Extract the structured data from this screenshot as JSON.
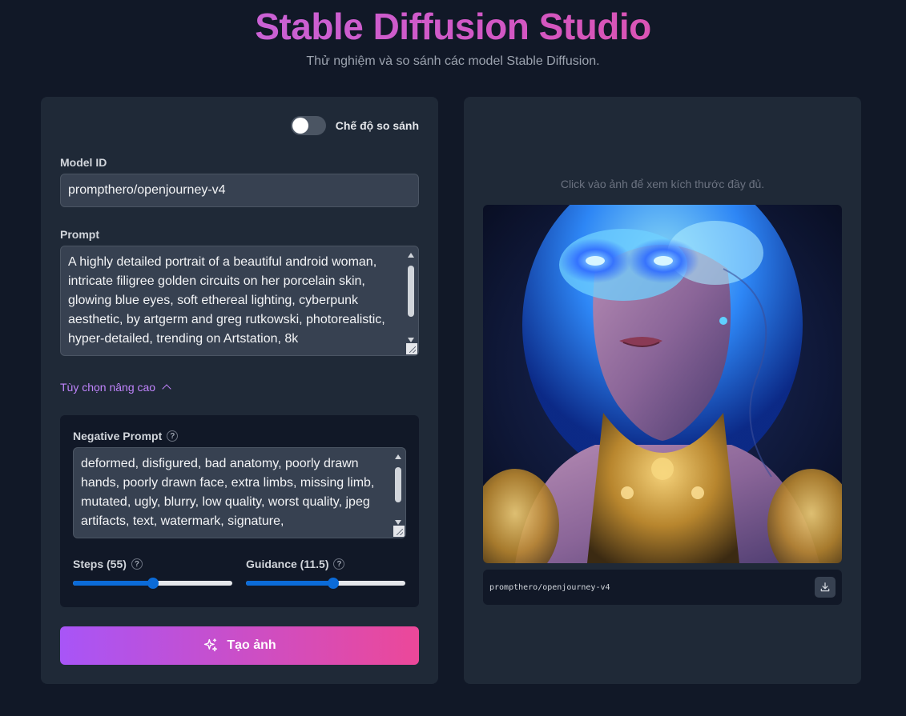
{
  "header": {
    "title": "Stable Diffusion Studio",
    "subtitle": "Thử nghiệm và so sánh các model Stable Diffusion."
  },
  "left_panel": {
    "compare_toggle": {
      "label": "Chế độ so sánh",
      "on": false
    },
    "model_id": {
      "label": "Model ID",
      "value": "prompthero/openjourney-v4"
    },
    "prompt": {
      "label": "Prompt",
      "value": "A highly detailed portrait of a beautiful android woman, intricate filigree golden circuits on her porcelain skin, glowing blue eyes, soft ethereal lighting, cyberpunk aesthetic, by artgerm and greg rutkowski, photorealistic, hyper-detailed, trending on Artstation, 8k"
    },
    "advanced": {
      "label": "Tùy chọn nâng cao",
      "expanded": true,
      "negative_prompt": {
        "label": "Negative Prompt",
        "value": "deformed, disfigured, bad anatomy, poorly drawn hands, poorly drawn face, extra limbs, missing limb, mutated, ugly, blurry, low quality, worst quality, jpeg artifacts, text, watermark, signature,"
      },
      "steps": {
        "label": "Steps (55)",
        "value": 55,
        "fraction": 0.5
      },
      "guidance": {
        "label": "Guidance (11.5)",
        "value": 11.5,
        "fraction": 0.55
      }
    },
    "generate_button": {
      "label": "Tạo ảnh",
      "icon": "sparkles-icon"
    }
  },
  "right_panel": {
    "hint": "Click vào ảnh để xem kích thước đầy đủ.",
    "image_caption": "prompthero/openjourney-v4",
    "download_icon": "download-icon"
  },
  "colors": {
    "background": "#111827",
    "panel": "#1f2937",
    "accent_purple": "#a855f7",
    "accent_pink": "#ec4899",
    "slider_blue": "#0b6bd8"
  }
}
